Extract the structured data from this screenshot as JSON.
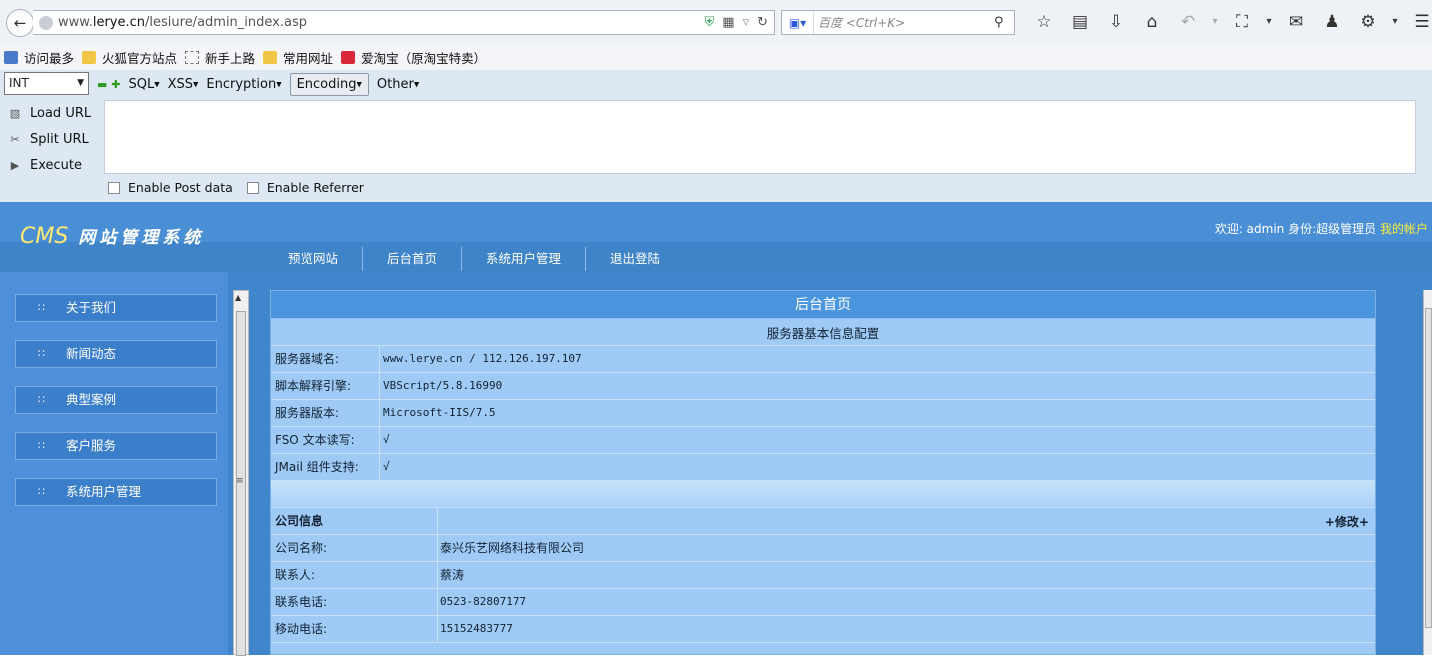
{
  "browser": {
    "url_prefix": "www.",
    "url_host": "lerye.cn",
    "url_path": "/lesiure/admin_index.asp",
    "search_placeholder": "百度 <Ctrl+K>",
    "bookmarks": [
      "访问最多",
      "火狐官方站点",
      "新手上路",
      "常用网址",
      "爱淘宝（原淘宝特卖）"
    ]
  },
  "hackbar": {
    "type_select": "INT",
    "menus": [
      "SQL",
      "XSS",
      "Encryption",
      "Encoding",
      "Other"
    ],
    "actions": [
      "Load URL",
      "Split URL",
      "Execute"
    ],
    "checkboxes": [
      "Enable Post data",
      "Enable Referrer"
    ]
  },
  "site": {
    "logo": "CMS",
    "logo_sub": "网站管理系统",
    "welcome": "欢迎:  admin 身份:超级管理员",
    "account_link": "我的帐户",
    "nav": [
      "预览网站",
      "后台首页",
      "系统用户管理",
      "退出登陆"
    ],
    "sidebar": [
      "关于我们",
      "新闻动态",
      "典型案例",
      "客户服务",
      "系统用户管理"
    ]
  },
  "panel": {
    "title": "后台首页",
    "server_section": "服务器基本信息配置",
    "server_rows": [
      {
        "k": "服务器域名:",
        "v": "www.lerye.cn / 112.126.197.107"
      },
      {
        "k": "脚本解释引擎:",
        "v": "VBScript/5.8.16990"
      },
      {
        "k": "服务器版本:",
        "v": "Microsoft-IIS/7.5"
      },
      {
        "k": "FSO 文本读写:",
        "v": "√"
      },
      {
        "k": "JMail 组件支持:",
        "v": "√"
      }
    ],
    "company_section": "公司信息",
    "edit_link": "+修改+",
    "company_rows": [
      {
        "k": "公司名称:",
        "v": "泰兴乐艺网络科技有限公司"
      },
      {
        "k": "联系人:",
        "v": "蔡涛"
      },
      {
        "k": "联系电话:",
        "v": "0523-82807177"
      },
      {
        "k": "移动电话:",
        "v": "15152483777"
      }
    ]
  }
}
